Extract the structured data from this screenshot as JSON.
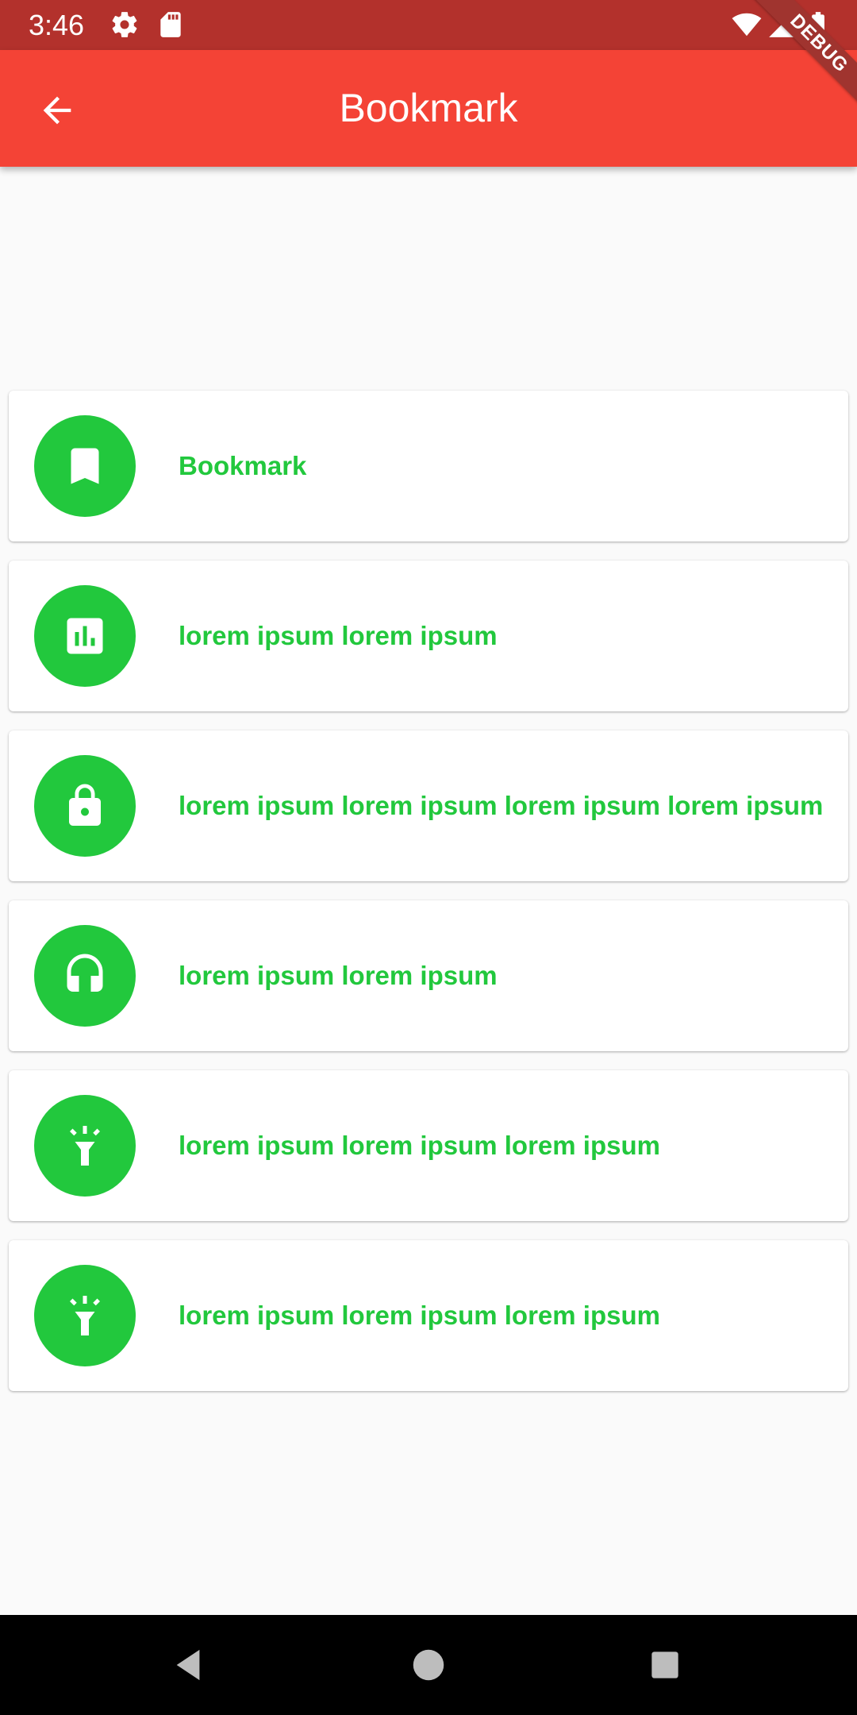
{
  "status_bar": {
    "time": "3:46",
    "icons": [
      "settings-icon",
      "sd-card-icon",
      "wifi-icon",
      "signal-icon",
      "battery-icon"
    ]
  },
  "app_bar": {
    "title": "Bookmark",
    "back_icon": "arrow-back-icon",
    "background": "#f44336"
  },
  "debug_banner": "DEBUG",
  "items": [
    {
      "icon": "bookmark-icon",
      "label": "Bookmark"
    },
    {
      "icon": "poll-icon",
      "label": "lorem ipsum lorem ipsum"
    },
    {
      "icon": "lock-icon",
      "label": "lorem ipsum lorem ipsum lorem ipsum lorem ipsum"
    },
    {
      "icon": "headset-icon",
      "label": "lorem ipsum lorem ipsum"
    },
    {
      "icon": "flashlight-icon",
      "label": "lorem ipsum lorem ipsum lorem ipsum"
    },
    {
      "icon": "flashlight-icon",
      "label": "lorem ipsum lorem ipsum lorem ipsum"
    }
  ],
  "colors": {
    "accent": "#22c83d",
    "status_bar": "#b3312c"
  },
  "nav_bar": [
    "back-triangle-icon",
    "home-circle-icon",
    "recents-square-icon"
  ]
}
